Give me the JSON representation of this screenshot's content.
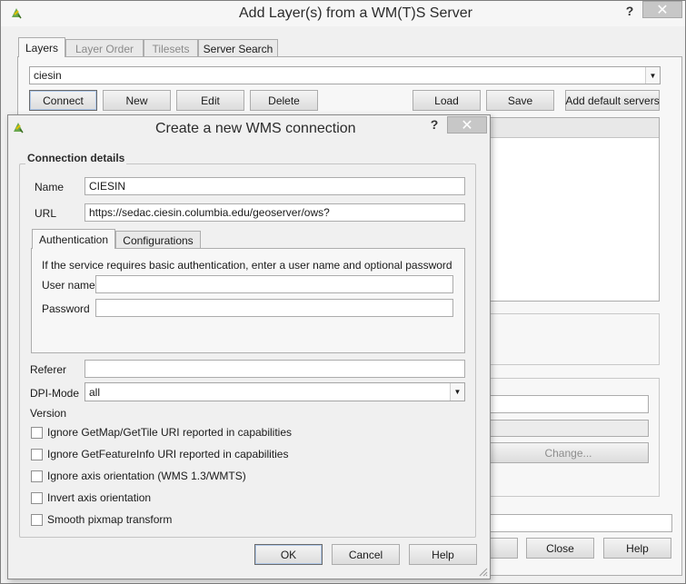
{
  "parent_window": {
    "title": "Add Layer(s) from a WM(T)S Server",
    "help_glyph": "?",
    "close_glyph": "✕",
    "tabs": [
      {
        "label": "Layers",
        "active": true
      },
      {
        "label": "Layer Order",
        "active": false
      },
      {
        "label": "Tilesets",
        "active": false
      },
      {
        "label": "Server Search",
        "active": false
      }
    ],
    "connection_value": "ciesin",
    "buttons": {
      "connect": "Connect",
      "new": "New",
      "edit": "Edit",
      "delete": "Delete",
      "load": "Load",
      "save": "Save",
      "add_default": "Add default servers",
      "change": "Change...",
      "close": "Close",
      "help": "Help"
    }
  },
  "dialog": {
    "title": "Create a new WMS connection",
    "help_glyph": "?",
    "close_glyph": "✕",
    "group_title": "Connection details",
    "name_label": "Name",
    "name_value": "CIESIN",
    "url_label": "URL",
    "url_value": "https://sedac.ciesin.columbia.edu/geoserver/ows?",
    "tabs": [
      {
        "label": "Authentication",
        "active": true
      },
      {
        "label": "Configurations",
        "active": false
      }
    ],
    "auth_note": "If the service requires basic authentication, enter a user name and optional password",
    "username_label": "User name",
    "username_value": "",
    "password_label": "Password",
    "password_value": "",
    "referer_label": "Referer",
    "referer_value": "",
    "dpi_label": "DPI-Mode",
    "dpi_value": "all",
    "version_label": "Version",
    "checkboxes": [
      {
        "label": "Ignore GetMap/GetTile URI reported in capabilities",
        "checked": false
      },
      {
        "label": "Ignore GetFeatureInfo URI reported in capabilities",
        "checked": false
      },
      {
        "label": "Ignore axis orientation (WMS 1.3/WMTS)",
        "checked": false
      },
      {
        "label": "Invert axis orientation",
        "checked": false
      },
      {
        "label": "Smooth pixmap transform",
        "checked": false
      }
    ],
    "buttons": {
      "ok": "OK",
      "cancel": "Cancel",
      "help": "Help"
    }
  },
  "colors": {
    "window_bg": "#f0f0f0",
    "icon_green": "#6aa84f",
    "icon_yellow": "#e0c000"
  }
}
